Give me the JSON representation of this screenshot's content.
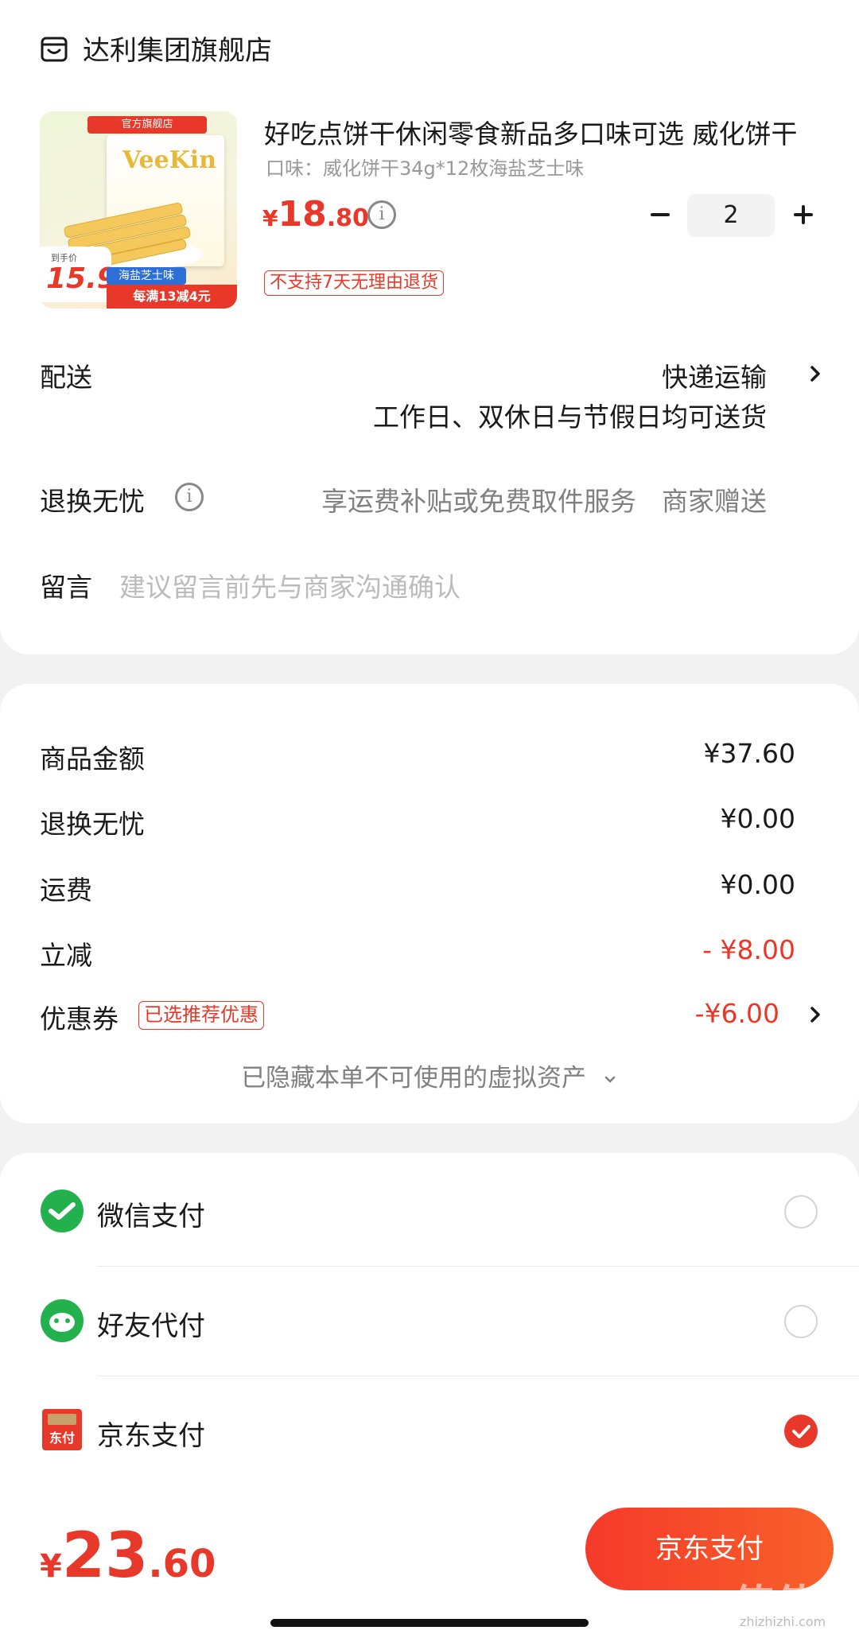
{
  "store": {
    "name": "达利集团旗舰店",
    "icon": "store-icon"
  },
  "product": {
    "title": "好吃点饼干休闲零食新品多口味可选 威化饼干",
    "spec": "口味：威化饼干34g*12枚海盐芝士味",
    "price_symbol": "¥",
    "price_int": "18",
    "price_dec": ".80",
    "quantity": "2",
    "no_return_tag": "不支持7天无理由退货",
    "image": {
      "shop_tag": "官方旗舰店",
      "brand": "VeeKin",
      "price_caption": "到手价",
      "price": "15.9",
      "flavor": "海盐芝士味",
      "promo": "每满13减4元"
    }
  },
  "delivery": {
    "label": "配送",
    "method": "快递运输",
    "note": "工作日、双休日与节假日均可送货"
  },
  "worry_free": {
    "label": "退换无忧",
    "desc": "享运费补贴或免费取件服务",
    "gift": "商家赠送"
  },
  "remark": {
    "label": "留言",
    "placeholder": "建议留言前先与商家沟通确认"
  },
  "fees": {
    "goods_label": "商品金额",
    "goods_value": "¥37.60",
    "worry_label": "退换无忧",
    "worry_value": "¥0.00",
    "shipping_label": "运费",
    "shipping_value": "¥0.00",
    "discount_label": "立减",
    "discount_value": "- ¥8.00",
    "coupon_label": "优惠券",
    "coupon_tag": "已选推荐优惠",
    "coupon_value": "-¥6.00",
    "hidden_assets": "已隐藏本单不可使用的虚拟资产"
  },
  "payments": [
    {
      "label": "微信支付",
      "icon": "wechat-pay-icon",
      "selected": false
    },
    {
      "label": "好友代付",
      "icon": "friend-pay-icon",
      "selected": false
    },
    {
      "label": "京东支付",
      "icon": "jd-pay-icon",
      "selected": true
    }
  ],
  "footer": {
    "total_symbol": "¥",
    "total_int": "23",
    "total_dec": ".60",
    "pay_button": "京东支付",
    "watermark": "值值值",
    "watermark_sub": "zhizhizhi.com"
  },
  "colors": {
    "accent": "#e8382a",
    "wechat_green": "#22b14c",
    "background": "#f2f2f2"
  }
}
